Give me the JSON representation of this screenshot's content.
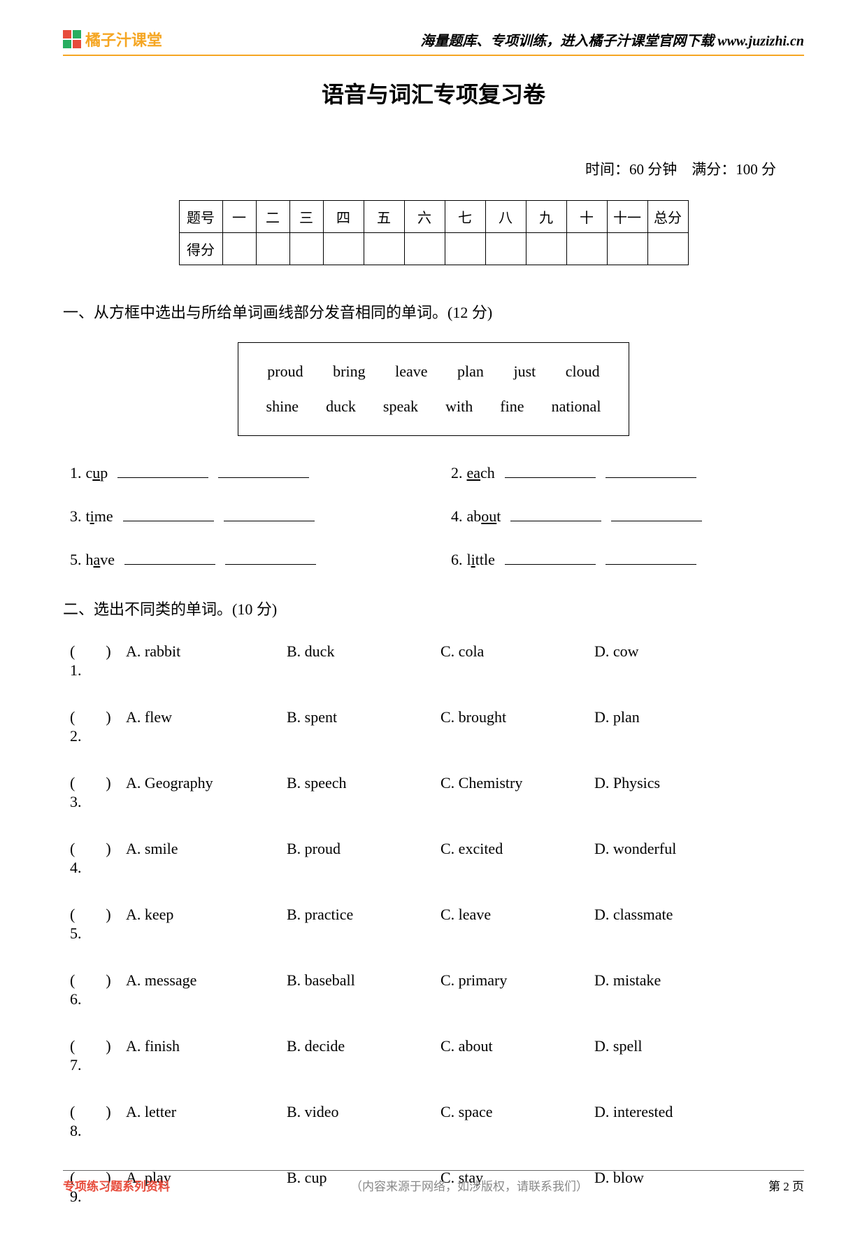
{
  "header": {
    "logo_text": "橘子汁课堂",
    "right_text": "海量题库、专项训练，进入橘子汁课堂官网下载 www.juzizhi.cn"
  },
  "title": "语音与词汇专项复习卷",
  "meta": "时间：60 分钟　满分：100 分",
  "score_table": {
    "row1": [
      "题号",
      "一",
      "二",
      "三",
      "四",
      "五",
      "六",
      "七",
      "八",
      "九",
      "十",
      "十一",
      "总分"
    ],
    "row2_label": "得分"
  },
  "section1": {
    "title": "一、从方框中选出与所给单词画线部分发音相同的单词。(12 分)",
    "box_row1": [
      "proud",
      "bring",
      "leave",
      "plan",
      "just",
      "cloud"
    ],
    "box_row2": [
      "shine",
      "duck",
      "speak",
      "with",
      "fine",
      "national"
    ],
    "items": [
      {
        "num": "1.",
        "pre": "c",
        "u": "u",
        "post": "p"
      },
      {
        "num": "2.",
        "pre": "",
        "u": "ea",
        "post": "ch"
      },
      {
        "num": "3.",
        "pre": "t",
        "u": "i",
        "post": "me"
      },
      {
        "num": "4.",
        "pre": "ab",
        "u": "ou",
        "post": "t"
      },
      {
        "num": "5.",
        "pre": "h",
        "u": "a",
        "post": "ve"
      },
      {
        "num": "6.",
        "pre": "l",
        "u": "i",
        "post": "ttle"
      }
    ]
  },
  "section2": {
    "title": "二、选出不同类的单词。(10 分)",
    "items": [
      {
        "n": "1",
        "A": "A. rabbit",
        "B": "B. duck",
        "C": "C. cola",
        "D": "D. cow"
      },
      {
        "n": "2",
        "A": "A. flew",
        "B": "B. spent",
        "C": "C. brought",
        "D": "D. plan"
      },
      {
        "n": "3",
        "A": "A. Geography",
        "B": "B. speech",
        "C": "C. Chemistry",
        "D": "D. Physics"
      },
      {
        "n": "4",
        "A": "A. smile",
        "B": "B. proud",
        "C": "C. excited",
        "D": "D. wonderful"
      },
      {
        "n": "5",
        "A": "A. keep",
        "B": "B. practice",
        "C": "C. leave",
        "D": "D. classmate"
      },
      {
        "n": "6",
        "A": "A. message",
        "B": "B. baseball",
        "C": "C. primary",
        "D": "D. mistake"
      },
      {
        "n": "7",
        "A": "A. finish",
        "B": "B. decide",
        "C": "C. about",
        "D": "D. spell"
      },
      {
        "n": "8",
        "A": "A. letter",
        "B": "B. video",
        "C": "C. space",
        "D": "D. interested"
      },
      {
        "n": "9",
        "A": "A. play",
        "B": "B. cup",
        "C": "C. stay",
        "D": "D. blow"
      }
    ]
  },
  "footer": {
    "left": "专项练习题系列资料",
    "mid": "（内容来源于网络，如涉版权，请联系我们）",
    "right": "第 2 页"
  }
}
